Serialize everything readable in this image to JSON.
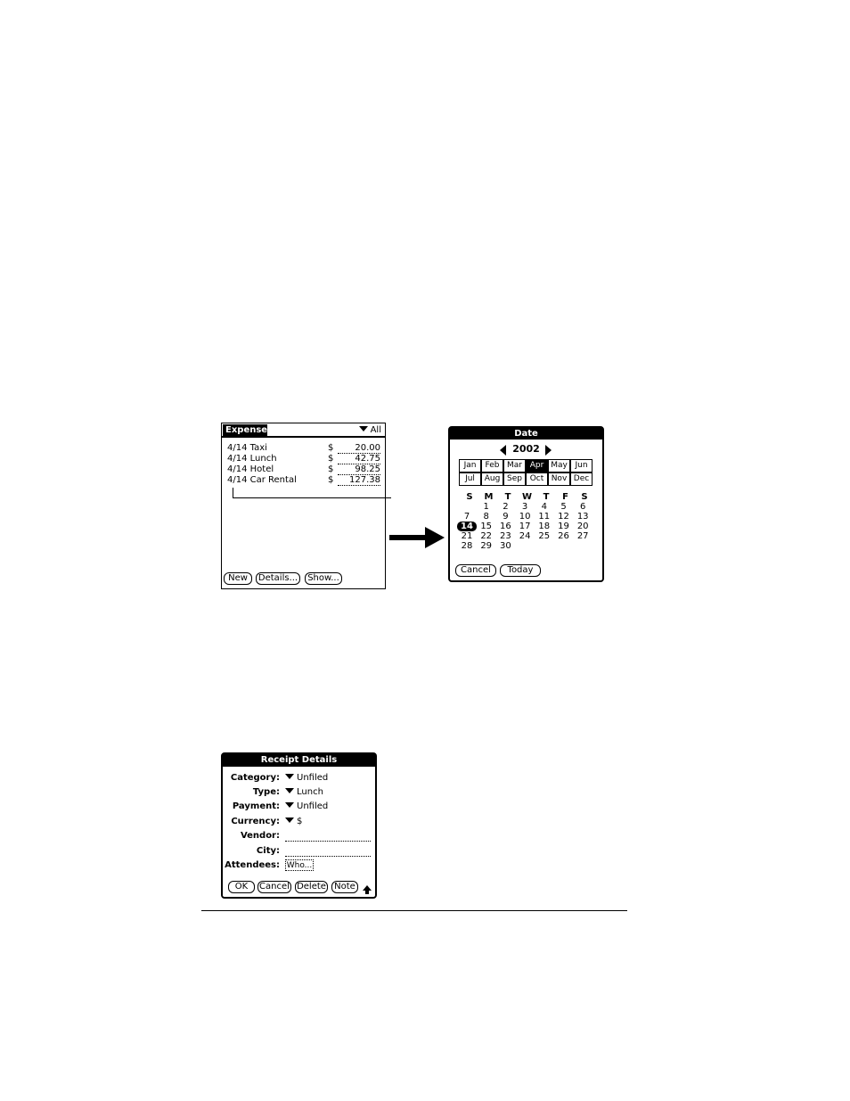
{
  "expense_list": {
    "title": "Expense",
    "category": "All",
    "rows": [
      {
        "desc": "4/14 Taxi",
        "currency": "$",
        "amount": "20.00"
      },
      {
        "desc": "4/14 Lunch",
        "currency": "$",
        "amount": "42.75"
      },
      {
        "desc": "4/14 Hotel",
        "currency": "$",
        "amount": "98.25"
      },
      {
        "desc": "4/14 Car Rental",
        "currency": "$",
        "amount": "127.38"
      }
    ],
    "buttons": {
      "new": "New",
      "details": "Details...",
      "show": "Show..."
    }
  },
  "date_picker": {
    "title": "Date",
    "year": "2002",
    "months": [
      "Jan",
      "Feb",
      "Mar",
      "Apr",
      "May",
      "Jun",
      "Jul",
      "Aug",
      "Sep",
      "Oct",
      "Nov",
      "Dec"
    ],
    "selected_month": "Apr",
    "weekdays": [
      "S",
      "M",
      "T",
      "W",
      "T",
      "F",
      "S"
    ],
    "weeks": [
      [
        "",
        "1",
        "2",
        "3",
        "4",
        "5",
        "6"
      ],
      [
        "7",
        "8",
        "9",
        "10",
        "11",
        "12",
        "13"
      ],
      [
        "14",
        "15",
        "16",
        "17",
        "18",
        "19",
        "20"
      ],
      [
        "21",
        "22",
        "23",
        "24",
        "25",
        "26",
        "27"
      ],
      [
        "28",
        "29",
        "30",
        "",
        "",
        "",
        ""
      ]
    ],
    "selected_day": "14",
    "buttons": {
      "cancel": "Cancel",
      "today": "Today"
    }
  },
  "receipt_details": {
    "title": "Receipt Details",
    "fields": {
      "category": {
        "label": "Category:",
        "value": "Unfiled"
      },
      "type": {
        "label": "Type:",
        "value": "Lunch"
      },
      "payment": {
        "label": "Payment:",
        "value": "Unfiled"
      },
      "currency": {
        "label": "Currency:",
        "value": "$"
      },
      "vendor": {
        "label": "Vendor:"
      },
      "city": {
        "label": "City:"
      },
      "attendees": {
        "label": "Attendees:",
        "value": "Who..."
      }
    },
    "buttons": {
      "ok": "OK",
      "cancel": "Cancel",
      "delete": "Delete",
      "note": "Note"
    }
  }
}
